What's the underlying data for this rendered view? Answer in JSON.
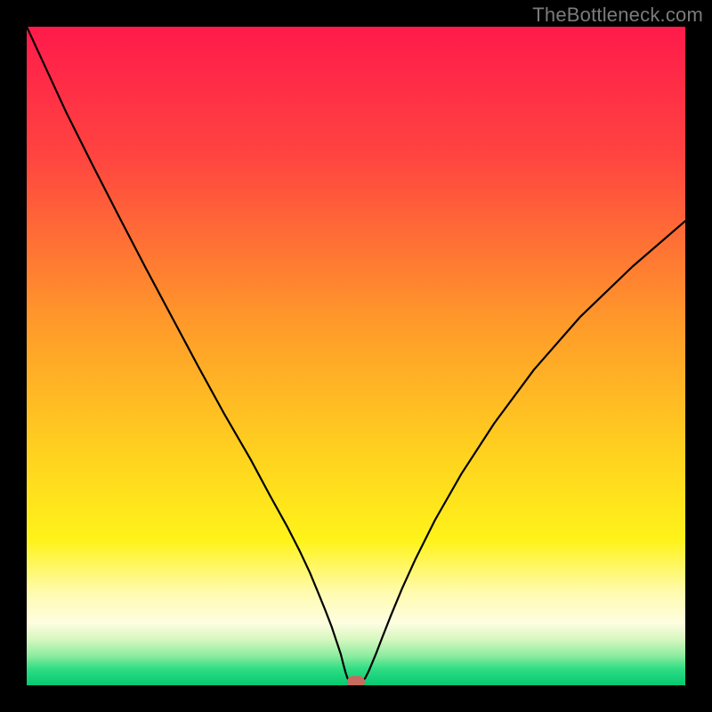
{
  "watermark": "TheBottleneck.com",
  "chart_data": {
    "type": "line",
    "title": "",
    "xlabel": "",
    "ylabel": "",
    "xlim": [
      0,
      100
    ],
    "ylim": [
      0,
      100
    ],
    "background_gradient": {
      "orientation": "vertical",
      "stops": [
        {
          "pos": 0.0,
          "color": "#ff1a4b"
        },
        {
          "pos": 0.2,
          "color": "#ff4540"
        },
        {
          "pos": 0.45,
          "color": "#ff9a2a"
        },
        {
          "pos": 0.65,
          "color": "#ffd21f"
        },
        {
          "pos": 0.78,
          "color": "#fff31a"
        },
        {
          "pos": 0.86,
          "color": "#fffbb0"
        },
        {
          "pos": 0.905,
          "color": "#fefee0"
        },
        {
          "pos": 0.93,
          "color": "#d7f7c0"
        },
        {
          "pos": 0.955,
          "color": "#8eec9f"
        },
        {
          "pos": 0.975,
          "color": "#2fdd84"
        },
        {
          "pos": 1.0,
          "color": "#05c971"
        }
      ]
    },
    "series": [
      {
        "name": "bottleneck-curve",
        "stroke": "#000000",
        "stroke_width": 2.2,
        "x": [
          0.0,
          3,
          6,
          10,
          14,
          18,
          22,
          26,
          30,
          34,
          37,
          39.5,
          41.5,
          43,
          44.2,
          45.3,
          46.3,
          47,
          47.7,
          48.1,
          48.4,
          48.7,
          49.1,
          50.9,
          51.4,
          52,
          53,
          54,
          55.3,
          57,
          59,
          62,
          66,
          71,
          77,
          84,
          92,
          100
        ],
        "y": [
          100,
          93.5,
          87,
          79,
          71.2,
          63.5,
          56,
          48.5,
          41.2,
          34.3,
          28.7,
          24.2,
          20.3,
          17.1,
          14.2,
          11.5,
          8.9,
          6.8,
          4.7,
          3.1,
          2.0,
          1.1,
          0.55,
          0.55,
          1.1,
          2.3,
          4.7,
          7.3,
          10.6,
          14.7,
          19.1,
          25.1,
          32.1,
          39.8,
          47.9,
          55.9,
          63.6,
          70.5
        ]
      }
    ],
    "minimum_marker": {
      "x": 50.0,
      "y": 0.55,
      "color": "#c86a5f"
    }
  }
}
